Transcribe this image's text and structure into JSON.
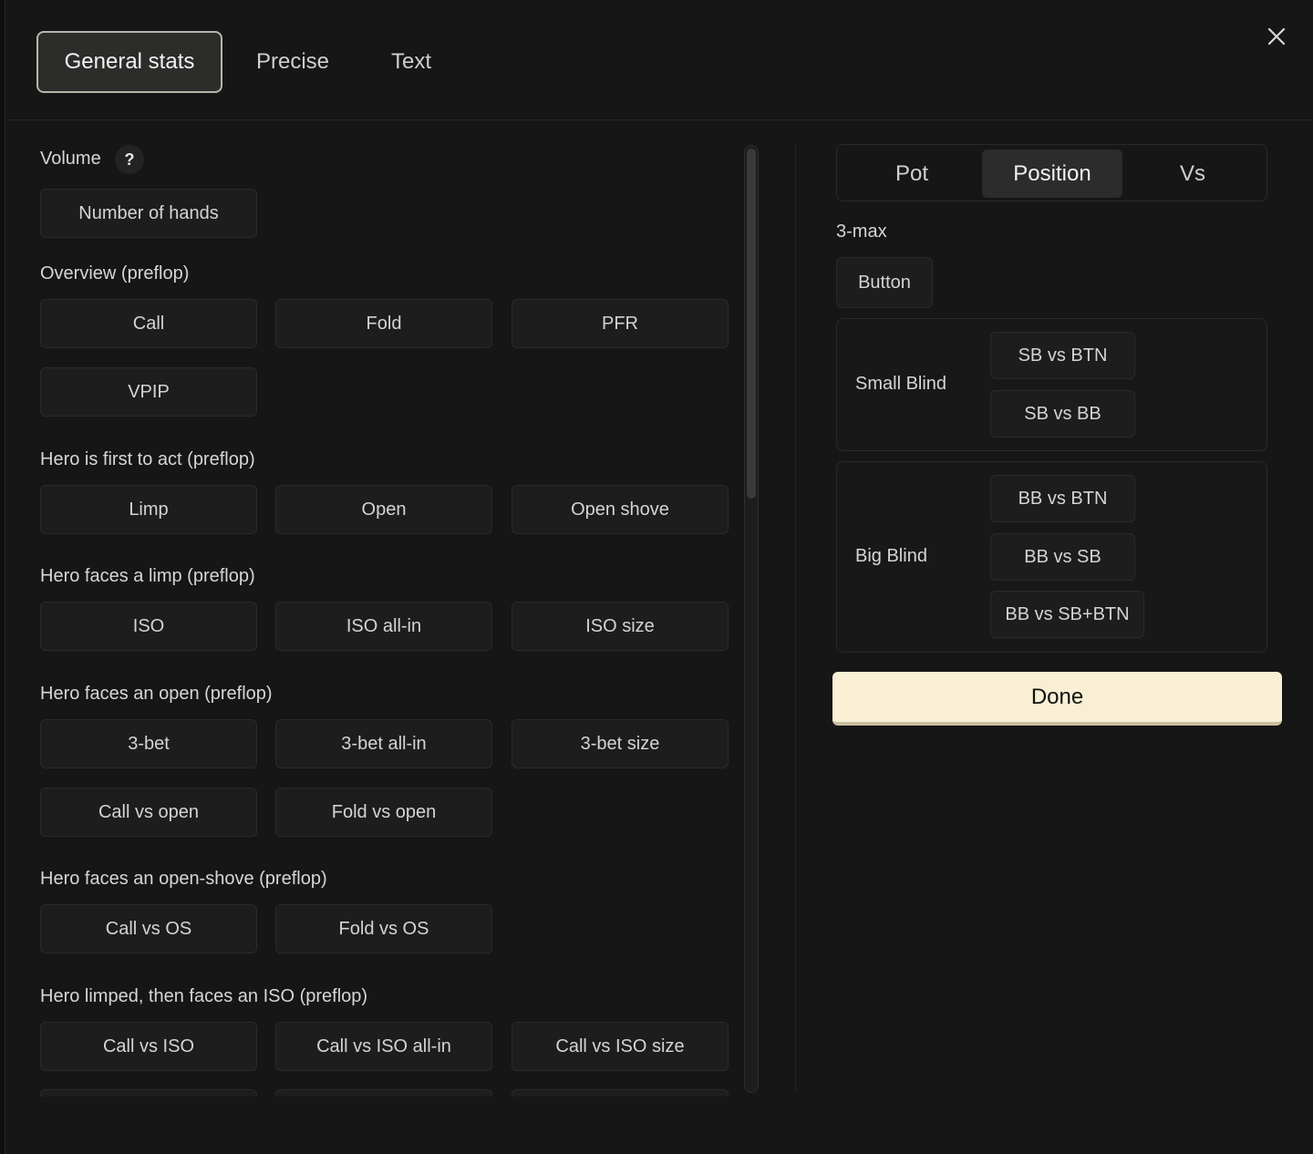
{
  "tabs": [
    "General stats",
    "Precise",
    "Text"
  ],
  "active_tab": "General stats",
  "left": {
    "volume": {
      "title": "Volume",
      "help": "?",
      "buttons": [
        "Number of hands"
      ]
    },
    "overview": {
      "title": "Overview (preflop)",
      "buttons": [
        "Call",
        "Fold",
        "PFR",
        "VPIP"
      ]
    },
    "first_to_act": {
      "title": "Hero is first to act (preflop)",
      "buttons": [
        "Limp",
        "Open",
        "Open shove"
      ]
    },
    "faces_limp": {
      "title": "Hero faces a limp (preflop)",
      "buttons": [
        "ISO",
        "ISO all-in",
        "ISO size"
      ]
    },
    "faces_open": {
      "title": "Hero faces an open (preflop)",
      "buttons": [
        "3-bet",
        "3-bet all-in",
        "3-bet size",
        "Call vs open",
        "Fold vs open"
      ]
    },
    "faces_open_shove": {
      "title": "Hero faces an open-shove (preflop)",
      "buttons": [
        "Call vs OS",
        "Fold vs OS"
      ]
    },
    "limped_faces_iso": {
      "title": "Hero limped, then faces an ISO (preflop)",
      "buttons": [
        "Call vs ISO",
        "Call vs ISO all-in",
        "Call vs ISO size"
      ]
    }
  },
  "right": {
    "segments": [
      "Pot",
      "Position",
      "Vs"
    ],
    "active_segment": "Position",
    "table_size": "3-max",
    "button": "Button",
    "small_blind": {
      "label": "Small Blind",
      "buttons": [
        "SB vs BTN",
        "SB vs BB"
      ]
    },
    "big_blind": {
      "label": "Big Blind",
      "buttons": [
        "BB vs BTN",
        "BB vs SB",
        "BB vs SB+BTN"
      ]
    },
    "done": "Done"
  },
  "colors": {
    "done_bg": "#f8efd4",
    "surface": "#161616",
    "button": "#1d1d1d"
  }
}
